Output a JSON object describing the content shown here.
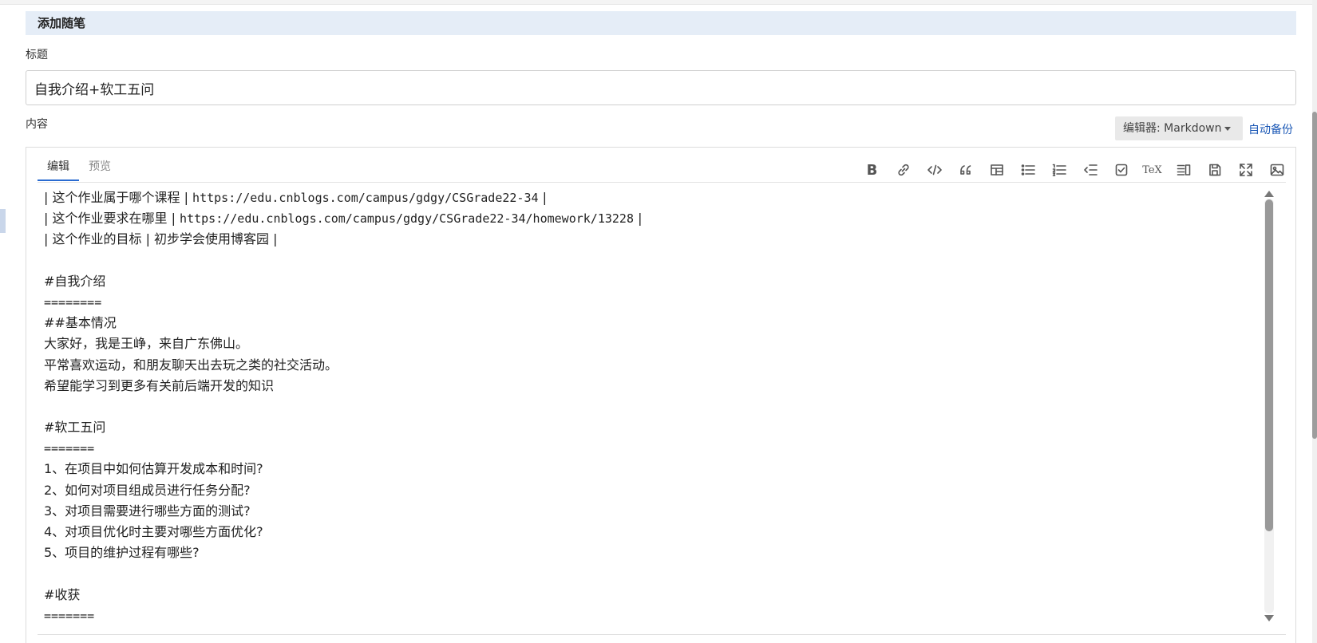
{
  "section": {
    "title": "添加随笔"
  },
  "title_field": {
    "label": "标题",
    "value": "自我介绍+软工五问"
  },
  "content_field": {
    "label": "内容"
  },
  "editor_select": {
    "label": "编辑器: Markdown"
  },
  "auto_backup": {
    "label": "自动备份"
  },
  "tabs": [
    {
      "label": "编辑",
      "active": true
    },
    {
      "label": "预览",
      "active": false
    }
  ],
  "toolbar": [
    {
      "icon": "bold-icon",
      "glyph": "B"
    },
    {
      "icon": "link-icon"
    },
    {
      "icon": "code-icon"
    },
    {
      "icon": "quote-icon"
    },
    {
      "icon": "table-icon"
    },
    {
      "icon": "bullet-list-icon"
    },
    {
      "icon": "numbered-list-icon"
    },
    {
      "icon": "outdent-icon"
    },
    {
      "icon": "checkbox-icon"
    },
    {
      "icon": "tex-icon",
      "glyph": "TeX"
    },
    {
      "icon": "toc-icon"
    },
    {
      "icon": "save-icon"
    },
    {
      "icon": "fullscreen-icon"
    },
    {
      "icon": "image-icon"
    }
  ],
  "content_lines": [
    "| 这个作业属于哪个课程 | https://edu.cnblogs.com/campus/gdgy/CSGrade22-34 |",
    "| 这个作业要求在哪里 | https://edu.cnblogs.com/campus/gdgy/CSGrade22-34/homework/13228 |",
    "| 这个作业的目标 | 初步学会使用博客园 |",
    "",
    "#自我介绍",
    "========",
    "##基本情况",
    "大家好，我是王峥，来自广东佛山。",
    "平常喜欢运动，和朋友聊天出去玩之类的社交活动。",
    "希望能学习到更多有关前后端开发的知识",
    "",
    "#软工五问",
    "=======",
    "1、在项目中如何估算开发成本和时间?",
    "2、如何对项目组成员进行任务分配?",
    "3、对项目需要进行哪些方面的测试?",
    "4、对项目优化时主要对哪些方面优化?",
    "5、项目的维护过程有哪些?",
    "",
    "#收获",
    "======="
  ]
}
